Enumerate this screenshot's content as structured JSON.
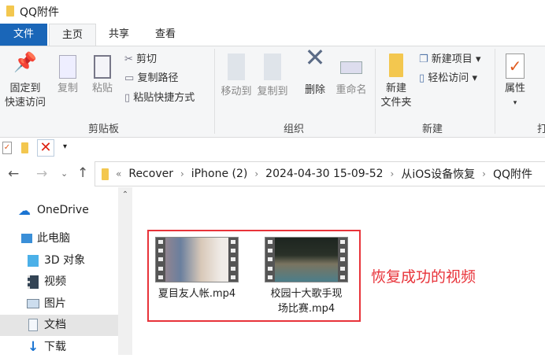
{
  "window": {
    "title": "QQ附件"
  },
  "tabs": [
    "文件",
    "主页",
    "共享",
    "查看"
  ],
  "ribbon": {
    "clipboard": {
      "pin": [
        "固定到",
        "快速访问"
      ],
      "copy": "复制",
      "paste": "粘贴",
      "cut": "剪切",
      "copy_path": "复制路径",
      "paste_shortcut": "粘贴快捷方式",
      "label": "剪贴板"
    },
    "organize": {
      "move_to": "移动到",
      "copy_to": "复制到",
      "delete": "删除",
      "rename": "重命名",
      "label": "组织"
    },
    "new": {
      "new_folder": [
        "新建",
        "文件夹"
      ],
      "new_item": "新建项目",
      "easy_access": "轻松访问",
      "label": "新建"
    },
    "open": {
      "properties": "属性",
      "label": "打"
    }
  },
  "address": {
    "overflow": "«",
    "crumbs": [
      "Recover",
      "iPhone (2)",
      "2024-04-30 15-09-52",
      "从iOS设备恢复",
      "QQ附件"
    ]
  },
  "nav": [
    "OneDrive",
    "此电脑",
    "3D 对象",
    "视频",
    "图片",
    "文档",
    "下载"
  ],
  "files": [
    {
      "name": "夏目友人帐.mp4"
    },
    {
      "name_lines": [
        "校园十大歌手现",
        "场比赛.mp4"
      ]
    }
  ],
  "annotation": {
    "text": "恢复成功的视频",
    "color": "#e8333a"
  }
}
